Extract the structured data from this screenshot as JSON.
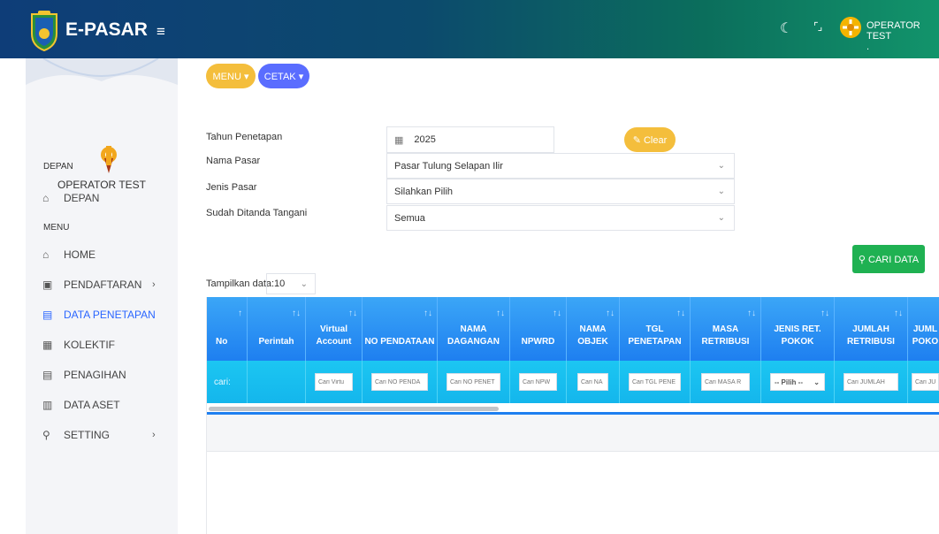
{
  "app": {
    "title": "E-PASAR",
    "username": "OPERATOR TEST",
    "username_suffix": "."
  },
  "sidebar": {
    "user_name": "OPERATOR TEST",
    "section_depan": "DEPAN",
    "section_menu": "MENU",
    "items": [
      {
        "label": "DEPAN",
        "icon": "home-outline-icon"
      },
      {
        "label": "HOME",
        "icon": "home-icon"
      },
      {
        "label": "PENDAFTARAN",
        "icon": "register-icon",
        "has_children": true
      },
      {
        "label": "DATA PENETAPAN",
        "icon": "calendar-icon",
        "active": true
      },
      {
        "label": "KOLEKTIF",
        "icon": "printer-icon"
      },
      {
        "label": "PENAGIHAN",
        "icon": "calendar-icon"
      },
      {
        "label": "DATA ASET",
        "icon": "document-icon"
      },
      {
        "label": "SETTING",
        "icon": "wrench-icon",
        "has_children": true
      }
    ]
  },
  "toolbar": {
    "menu_label": "MENU",
    "cetak_label": "CETAK"
  },
  "form": {
    "tahun_label": "Tahun Penetapan",
    "tahun_value": "2025",
    "clear_label": "Clear",
    "nama_pasar_label": "Nama Pasar",
    "nama_pasar_value": "Pasar Tulung Selapan Ilir",
    "jenis_pasar_label": "Jenis Pasar",
    "jenis_pasar_value": "Silahkan Pilih",
    "ditanda_label": "Sudah Ditanda Tangani",
    "ditanda_value": "Semua",
    "cari_label": "CARI DATA"
  },
  "table": {
    "show_label": "Tampilkan data:",
    "show_value": "10",
    "columns": [
      {
        "label": "No"
      },
      {
        "label": "Perintah"
      },
      {
        "label": "Virtual Account"
      },
      {
        "label": "NO PENDATAAN"
      },
      {
        "label": "NAMA DAGANGAN"
      },
      {
        "label": "NPWRD"
      },
      {
        "label": "NAMA OBJEK"
      },
      {
        "label": "TGL PENETAPAN"
      },
      {
        "label": "MASA RETRIBUSI"
      },
      {
        "label": "JENIS RET. POKOK"
      },
      {
        "label": "JUMLAH RETRIBUSI"
      },
      {
        "label": "JUML POKO"
      }
    ],
    "filter_cari": "cari:",
    "filters": [
      "Cari Virtu",
      "Cari NO PENDA",
      "Cari NO PENET",
      "Cari NPW",
      "Cari NA",
      "Cari TGL PENE",
      "Cari MASA R",
      "-- Pilih --",
      "Cari JUMLAH",
      "Cari JU"
    ]
  },
  "colors": {
    "header_start": "#0e3d78",
    "header_end": "#12946b",
    "accent": "#2b66ff",
    "table_head": "#1e7ff0",
    "table_filter": "#14b6ec",
    "btn_yellow": "#f4be3c",
    "btn_green": "#1fb152"
  }
}
